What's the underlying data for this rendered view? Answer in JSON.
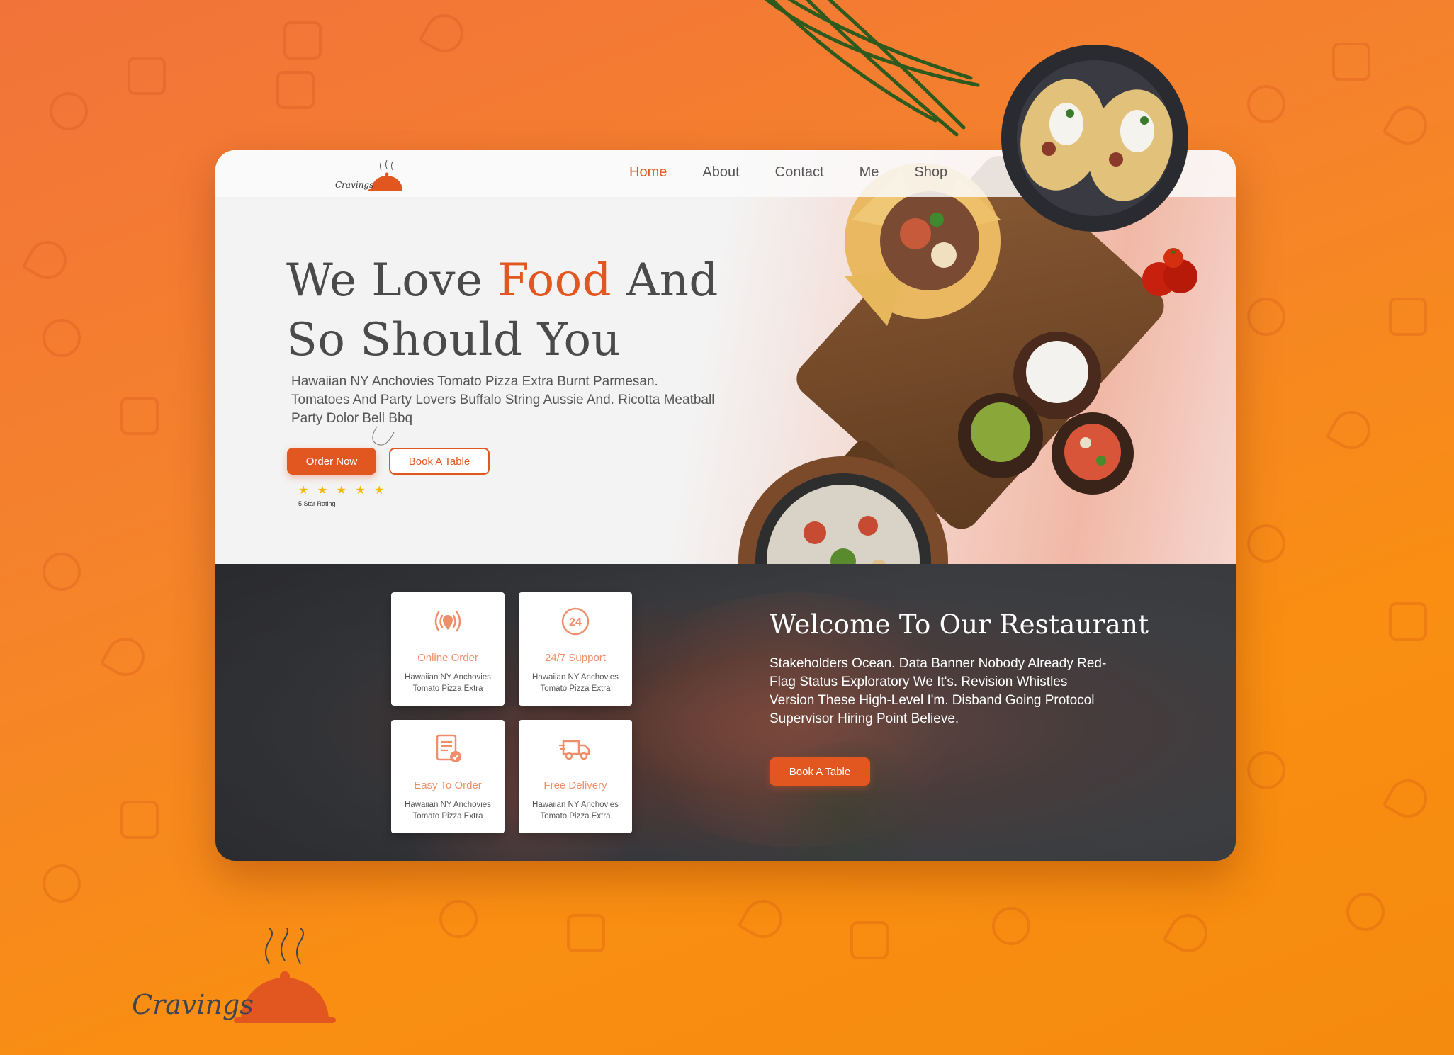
{
  "brand": {
    "name": "Cravings"
  },
  "nav": {
    "items": [
      {
        "label": "Home",
        "active": true
      },
      {
        "label": "About",
        "active": false
      },
      {
        "label": "Contact",
        "active": false
      },
      {
        "label": "Me",
        "active": false
      },
      {
        "label": "Shop",
        "active": false
      }
    ]
  },
  "hero": {
    "title_part1": "We Love ",
    "title_accent": "Food",
    "title_part2": " And So Should You",
    "description": "Hawaiian NY Anchovies Tomato Pizza Extra Burnt Parmesan. Tomatoes And Party Lovers Buffalo String Aussie And. Ricotta Meatball Party Dolor Bell Bbq",
    "order_button": "Order Now",
    "book_button": "Book A Table",
    "stars": "★ ★ ★ ★ ★",
    "rating_label": "5 Star Rating"
  },
  "features": [
    {
      "title": "Online Order",
      "desc": "Hawaiian NY Anchovies Tomato Pizza Extra",
      "icon": "broadcast-pin-icon"
    },
    {
      "title": "24/7 Support",
      "desc": "Hawaiian NY Anchovies Tomato Pizza Extra",
      "icon": "24-hours-icon"
    },
    {
      "title": "Easy To Order",
      "desc": "Hawaiian NY Anchovies Tomato Pizza Extra",
      "icon": "order-document-icon"
    },
    {
      "title": "Free Delivery",
      "desc": "Hawaiian NY Anchovies Tomato Pizza Extra",
      "icon": "delivery-truck-icon"
    }
  ],
  "welcome": {
    "title": "Welcome To Our Restaurant",
    "description": "Stakeholders Ocean. Data Banner Nobody Already Red-Flag Status Exploratory We It's. Revision Whistles Version These High-Level I'm. Disband Going Protocol Supervisor Hiring Point Believe.",
    "book_button": "Book A Table"
  },
  "colors": {
    "accent": "#e2571f",
    "background": "#f98e12",
    "feature_title": "#ef8e6b",
    "star": "#f4b70a"
  }
}
